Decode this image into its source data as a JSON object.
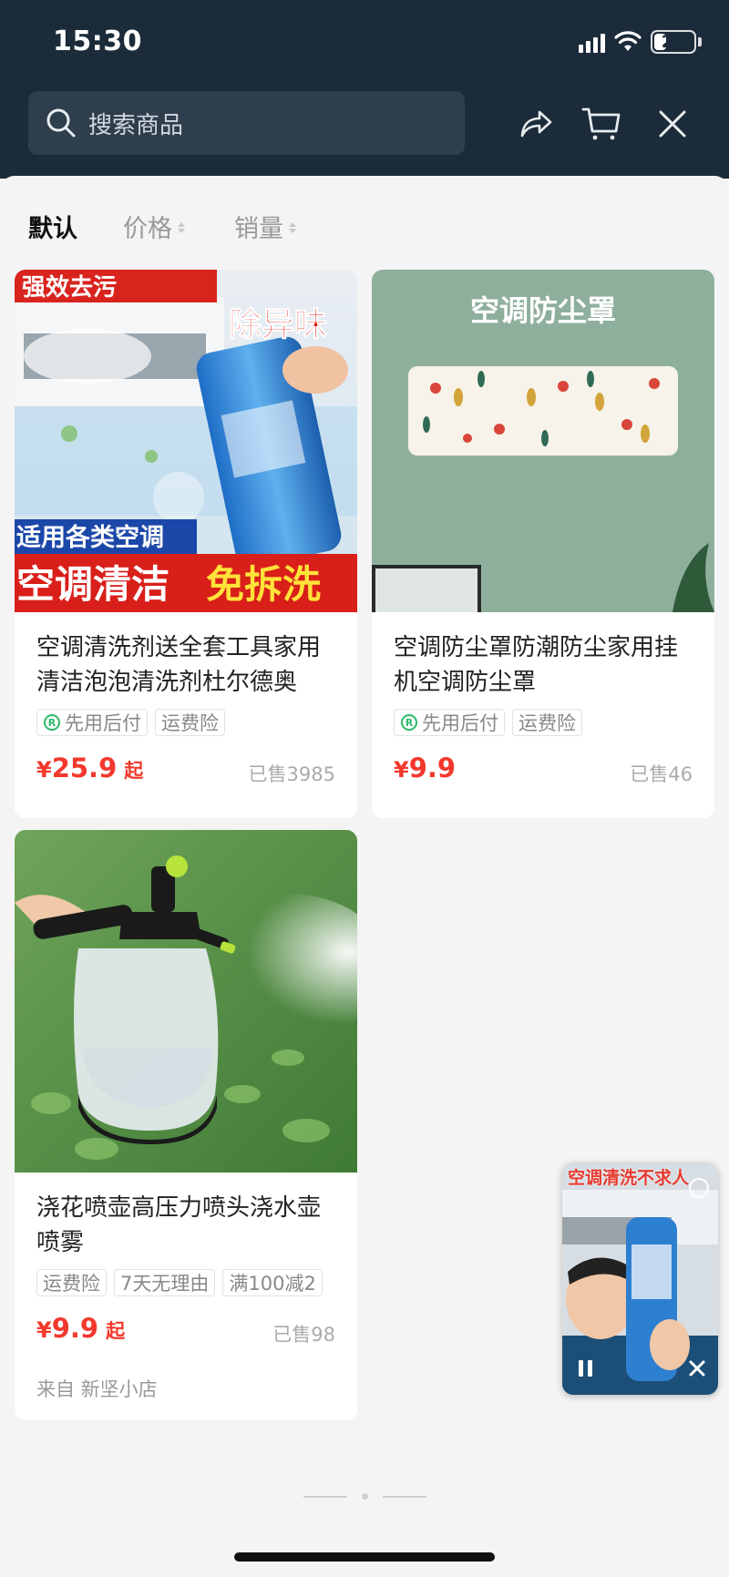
{
  "status_bar": {
    "time": "15:30",
    "battery": "27"
  },
  "header": {
    "search_placeholder": "搜索商品"
  },
  "sort": {
    "default": "默认",
    "price": "价格",
    "sales": "销量"
  },
  "products": [
    {
      "title": "空调清洗剂送全套工具家用清洁泡泡清洗剂杜尔德奥",
      "image_text": {
        "top_left": "强效去污",
        "top_right": "除异味",
        "mid": "适用各类空调",
        "bottom_left": "空调清洁",
        "bottom_right": "免拆洗"
      },
      "tags": [
        "先用后付",
        "运费险"
      ],
      "price_symbol": "¥",
      "price": "25.9",
      "price_suffix": "起",
      "sold": "已售3985"
    },
    {
      "title": "空调防尘罩防潮防尘家用挂机空调防尘罩",
      "image_text": {
        "heading": "空调防尘罩"
      },
      "tags": [
        "先用后付",
        "运费险"
      ],
      "price_symbol": "¥",
      "price": "9.9",
      "sold": "已售46"
    },
    {
      "title": "浇花喷壶高压力喷头浇水壶喷雾",
      "tags": [
        "运费险",
        "7天无理由",
        "满100减2"
      ],
      "price_symbol": "¥",
      "price": "9.9",
      "price_suffix": "起",
      "sold": "已售98",
      "shop": "来自 新坚小店"
    }
  ],
  "floating_video": {
    "caption": "空调清洗不求人"
  },
  "colors": {
    "header_bg": "#1b2b3a",
    "price_red": "#f2382c",
    "pay_later_green": "#2cb86a"
  }
}
